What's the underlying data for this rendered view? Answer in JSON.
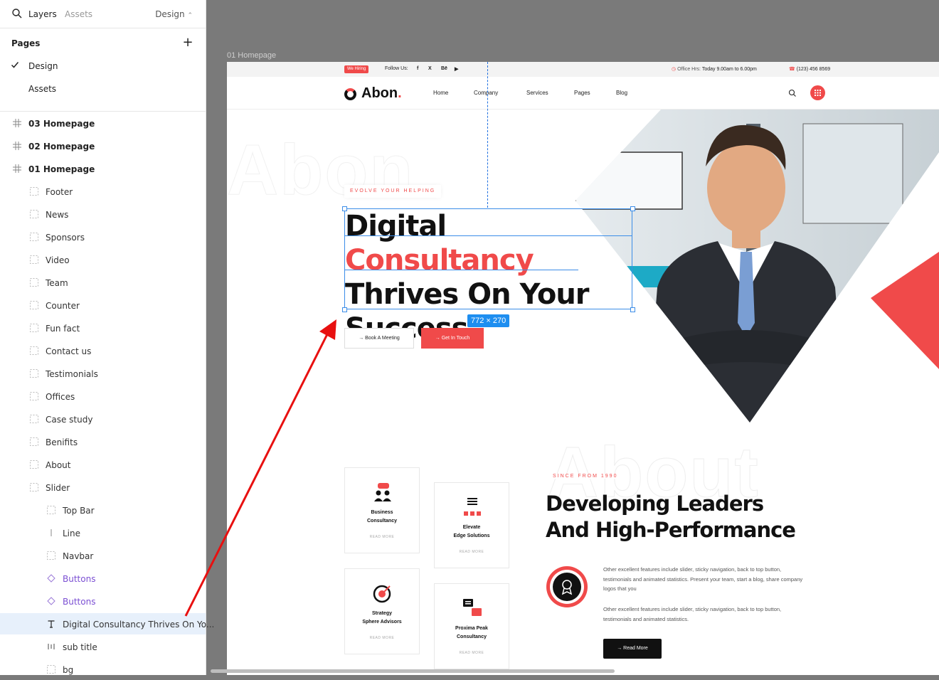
{
  "panel": {
    "tabs": [
      "Layers",
      "Assets"
    ],
    "page_dropdown": "Design",
    "pages_heading": "Pages",
    "pages": [
      "Design",
      "Assets"
    ],
    "layers": [
      {
        "label": "03 Homepage",
        "kind": "frame",
        "indent": 0
      },
      {
        "label": "02 Homepage",
        "kind": "frame",
        "indent": 0
      },
      {
        "label": "01 Homepage",
        "kind": "frame",
        "indent": 0
      },
      {
        "label": "Footer",
        "kind": "section",
        "indent": 1
      },
      {
        "label": "News",
        "kind": "section",
        "indent": 1
      },
      {
        "label": "Sponsors",
        "kind": "section",
        "indent": 1
      },
      {
        "label": "Video",
        "kind": "section",
        "indent": 1
      },
      {
        "label": "Team",
        "kind": "section",
        "indent": 1
      },
      {
        "label": "Counter",
        "kind": "section",
        "indent": 1
      },
      {
        "label": "Fun fact",
        "kind": "section",
        "indent": 1
      },
      {
        "label": "Contact us",
        "kind": "section",
        "indent": 1
      },
      {
        "label": "Testimonials",
        "kind": "section",
        "indent": 1
      },
      {
        "label": "Offices",
        "kind": "section",
        "indent": 1
      },
      {
        "label": "Case study",
        "kind": "section",
        "indent": 1
      },
      {
        "label": "Benifits",
        "kind": "section",
        "indent": 1
      },
      {
        "label": "About",
        "kind": "section",
        "indent": 1
      },
      {
        "label": "Slider",
        "kind": "section",
        "indent": 1
      },
      {
        "label": "Top Bar",
        "kind": "section",
        "indent": 2
      },
      {
        "label": "Line",
        "kind": "line",
        "indent": 2
      },
      {
        "label": "Navbar",
        "kind": "section",
        "indent": 2
      },
      {
        "label": "Buttons",
        "kind": "component",
        "indent": 2
      },
      {
        "label": "Buttons",
        "kind": "component",
        "indent": 2
      },
      {
        "label": "Digital Consultancy Thrives On Yo...",
        "kind": "text",
        "indent": 2,
        "selected": true
      },
      {
        "label": "sub title",
        "kind": "autolayout",
        "indent": 2
      },
      {
        "label": "bg",
        "kind": "section",
        "indent": 2
      }
    ]
  },
  "canvas": {
    "frame_label": "01 Homepage",
    "selection_size": "772 × 270"
  },
  "site": {
    "topbar": {
      "hiring": "We Hiring",
      "follow": "Follow Us:",
      "socials": [
        "f",
        "X",
        "Bē",
        "▶"
      ],
      "hours_label": "Office Hrs:",
      "hours_value": "Today 9.00am to 6.00pm",
      "phone": "(123) 456 8569"
    },
    "logo": "Abon",
    "nav": [
      "Home",
      "Company",
      "Services",
      "Pages",
      "Blog"
    ],
    "hero": {
      "bg_word": "Abon",
      "eyebrow": "EVOLVE YOUR HELPING",
      "headline_black": "Digital",
      "headline_red": "Consultancy",
      "headline_rest1": "Thrives On Your",
      "headline_rest2": "Success",
      "btn_primary": "Book A Meeting",
      "btn_secondary": "Get In Touch"
    },
    "services": [
      {
        "title1": "Business",
        "title2": "Consultancy",
        "more": "READ MORE"
      },
      {
        "title1": "Elevate",
        "title2": "Edge Solutions",
        "more": "READ MORE"
      },
      {
        "title1": "Strategy",
        "title2": "Sphere Advisors",
        "more": "READ MORE"
      },
      {
        "title1": "Proxima Peak",
        "title2": "Consultancy",
        "more": "READ MORE"
      }
    ],
    "about": {
      "bg_word": "About",
      "since": "SINCE FROM 1990",
      "heading1": "Developing Leaders",
      "heading2": "And High-Performance",
      "para1": "Other excellent features include slider, sticky navigation, back to top button, testimonials and animated statistics. Present your team, start a blog, share company logos that you",
      "para2": "Other excellent features include slider, sticky navigation, back to top button, testimonials and animated statistics.",
      "btn": "Read More"
    }
  },
  "colors": {
    "accent": "#f04a4a",
    "selection": "#1e8ef0",
    "annotation_arrow": "#e81010"
  }
}
